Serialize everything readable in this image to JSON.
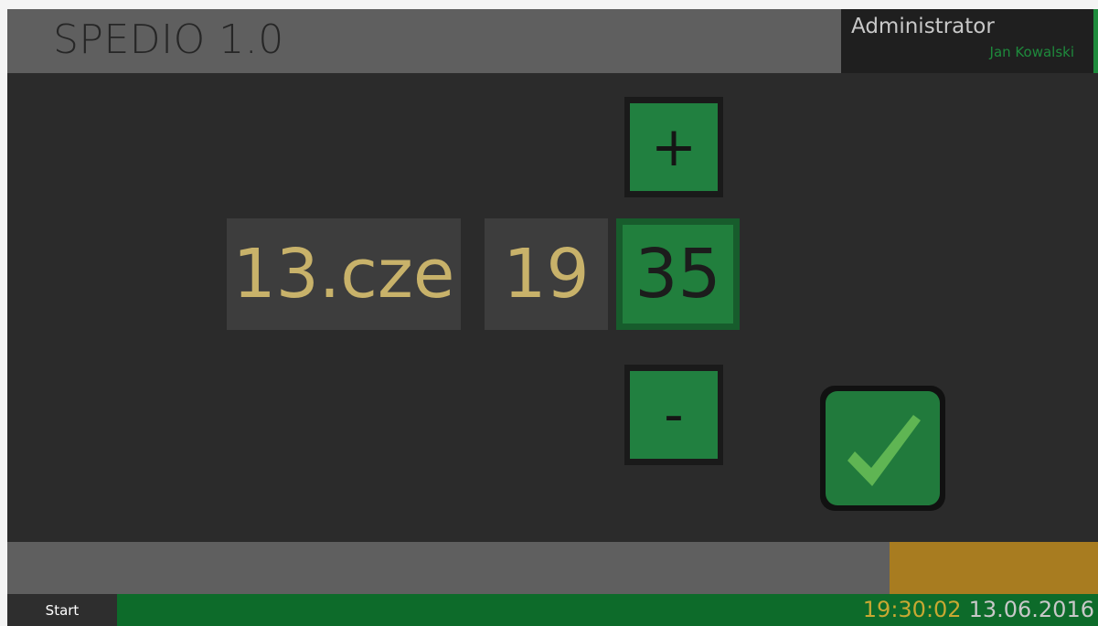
{
  "header": {
    "app_title": "SPEDIO 1.0",
    "user_role": "Administrator",
    "user_name": "Jan Kowalski"
  },
  "datetime_picker": {
    "date": "13.cze",
    "hour": "19",
    "minute": "35",
    "increment_label": "+",
    "decrement_label": "-",
    "selected_field": "minute"
  },
  "confirm": {
    "icon": "checkmark-icon"
  },
  "taskbar": {
    "start_label": "Start",
    "time": "19:30:02",
    "date": "13.06.2016"
  },
  "colors": {
    "accent_green": "#217f3d",
    "value_gold": "#c8b26a",
    "clock_time": "#c8a832",
    "status_accent": "#a87c20",
    "background": "#2b2b2b"
  }
}
